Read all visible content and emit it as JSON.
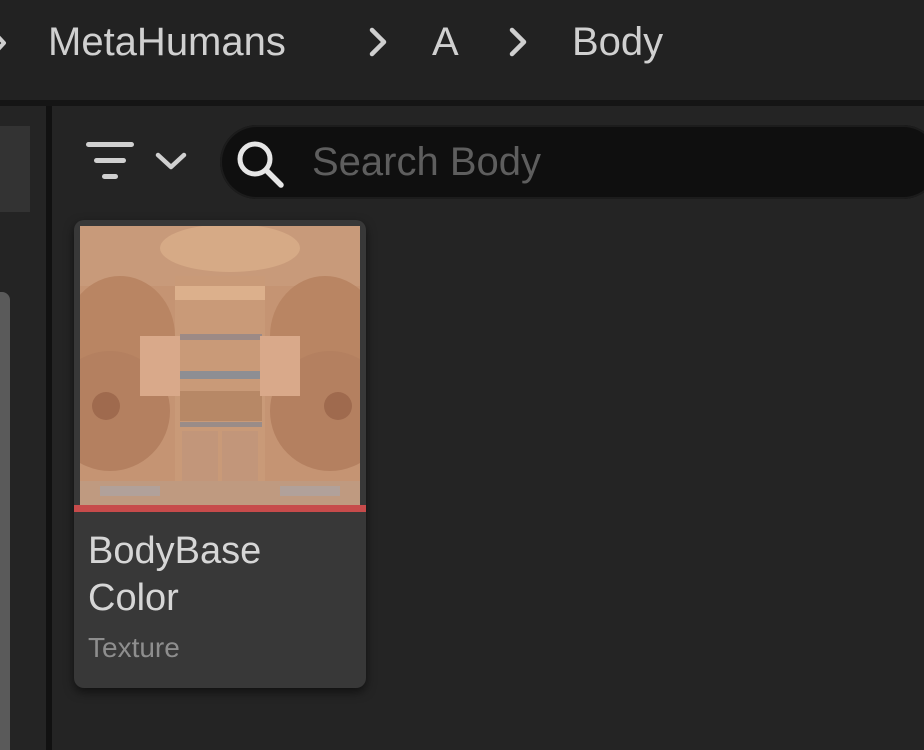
{
  "breadcrumb": {
    "items": [
      {
        "label": "MetaHumans"
      },
      {
        "label": "A"
      },
      {
        "label": "Body"
      }
    ]
  },
  "search": {
    "placeholder": "Search Body",
    "value": ""
  },
  "assets": [
    {
      "name": "BodyBase Color",
      "type": "Texture",
      "type_color": "#c74b4b"
    }
  ],
  "colors": {
    "background": "#1a1a1a",
    "panel": "#242424",
    "text": "#d0d0d0",
    "texture_type_accent": "#c74b4b"
  },
  "icons": {
    "filter": "filter-icon",
    "dropdown": "chevron-down-icon",
    "search": "search-icon",
    "breadcrumb_separator": "chevron-right-icon"
  }
}
